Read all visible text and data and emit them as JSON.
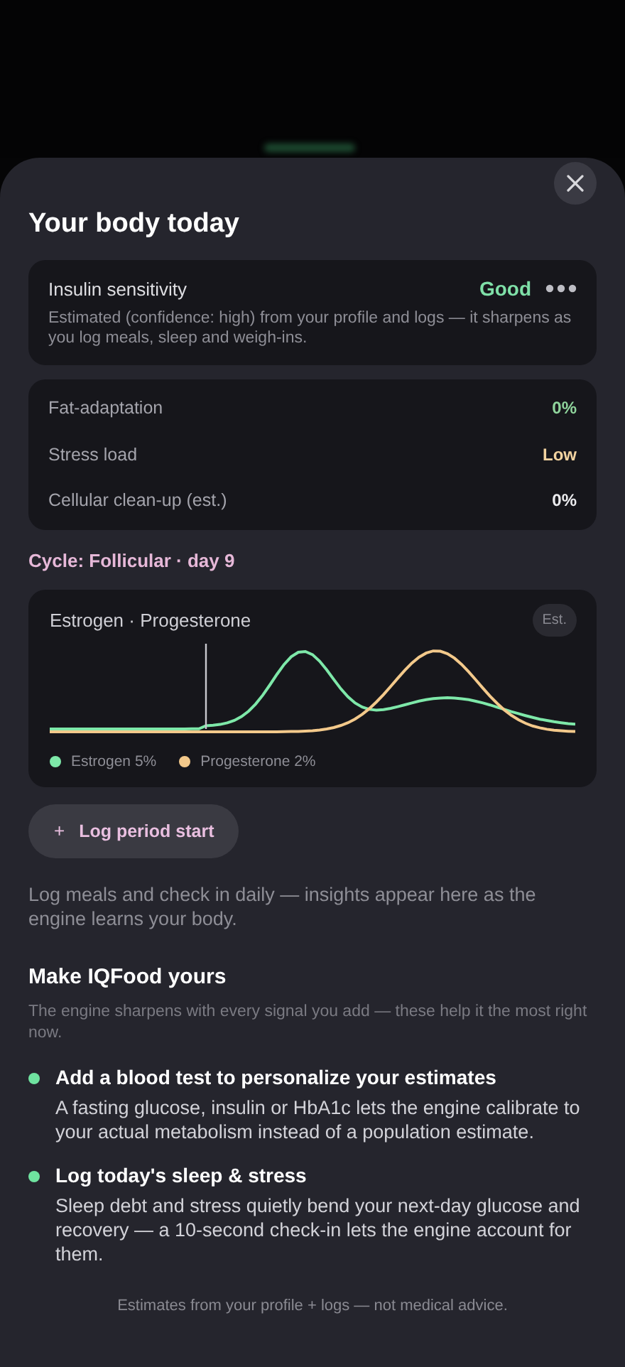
{
  "title": "Your body today",
  "insulin": {
    "label": "Insulin sensitivity",
    "value": "Good",
    "color": "#7fe0a8",
    "note": "Estimated (confidence: high) from your profile and logs — it sharpens as you log meals, sleep and weigh-ins."
  },
  "metrics": [
    {
      "label": "Fat-adaptation",
      "value": "0%",
      "color": "#8fd49c"
    },
    {
      "label": "Stress load",
      "value": "Low",
      "color": "#f2d3a0"
    },
    {
      "label": "Cellular clean-up (est.)",
      "value": "0%",
      "color": "#ececef"
    }
  ],
  "cycle": "Cycle: Follicular · day 9",
  "hormone_card": {
    "title": "Estrogen · Progesterone",
    "badge": "Est.",
    "legend": [
      {
        "label": "Estrogen 5%",
        "color": "#7ee8a9"
      },
      {
        "label": "Progesterone 2%",
        "color": "#f3c98b"
      }
    ]
  },
  "log_button": {
    "icon": "+",
    "label": "Log period start"
  },
  "hint": "Log meals and check in daily — insights appear here as the engine learns your body.",
  "personalize": {
    "title": "Make IQFood yours",
    "subtitle": "The engine sharpens with every signal you add — these help it the most right now.",
    "items": [
      {
        "title": "Add a blood test to personalize your estimates",
        "body": "A fasting glucose, insulin or HbA1c lets the engine calibrate to your actual metabolism instead of a population estimate.",
        "color": "#6fe3a0"
      },
      {
        "title": "Log today's sleep & stress",
        "body": "Sleep debt and stress quietly bend your next-day glucose and recovery — a 10-second check-in lets the engine account for them.",
        "color": "#6fe3a0"
      }
    ]
  },
  "footer": "Estimates from your profile + logs — not medical advice."
}
